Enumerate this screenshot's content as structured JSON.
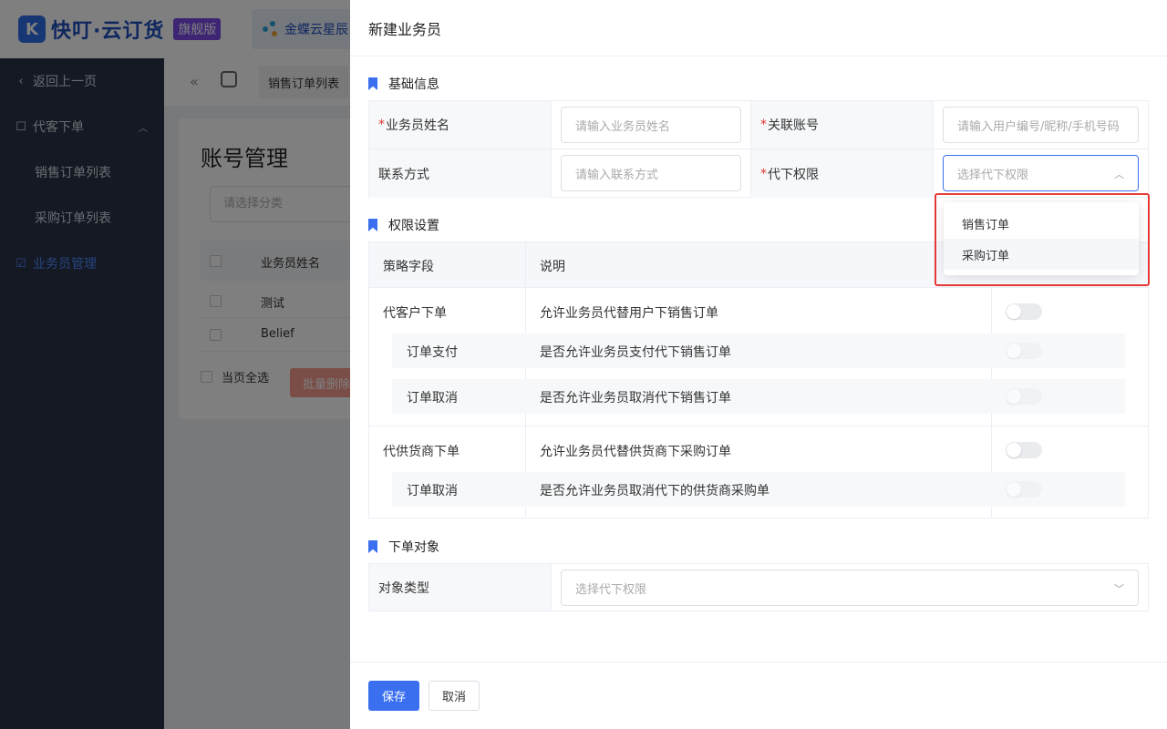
{
  "brand": {
    "logo_mark": "K",
    "name": "快叮·云订货",
    "badge": "旗舰版",
    "partner_tab": "金蝶云星辰"
  },
  "sidebar": {
    "back": "返回上一页",
    "group": "代客下单",
    "items": [
      {
        "label": "销售订单列表"
      },
      {
        "label": "采购订单列表"
      }
    ],
    "active": "业务员管理"
  },
  "breadcrumb": {
    "tab": "销售订单列表"
  },
  "page": {
    "title": "账号管理",
    "category_placeholder": "请选择分类",
    "table_header": "业务员姓名",
    "rows": [
      {
        "name": "测试"
      },
      {
        "name": "Belief"
      }
    ],
    "select_all": "当页全选",
    "bulk_delete": "批量删除"
  },
  "drawer": {
    "title": "新建业务员",
    "basic": {
      "title": "基础信息",
      "name_label": "业务员姓名",
      "name_placeholder": "请输入业务员姓名",
      "account_label": "关联账号",
      "account_placeholder": "请输入用户编号/昵称/手机号码",
      "contact_label": "联系方式",
      "contact_placeholder": "请输入联系方式",
      "proxy_label": "代下权限",
      "proxy_placeholder": "选择代下权限"
    },
    "perm": {
      "title": "权限设置",
      "col_field": "策略字段",
      "col_desc": "说明",
      "rows": [
        {
          "field": "代客户下单",
          "desc": "允许业务员代替用户下销售订单"
        },
        {
          "field": "订单支付",
          "desc": "是否允许业务员支付代下销售订单"
        },
        {
          "field": "订单取消",
          "desc": "是否允许业务员取消代下销售订单"
        },
        {
          "field": "代供货商下单",
          "desc": "允许业务员代替供货商下采购订单"
        },
        {
          "field": "订单取消",
          "desc": "是否允许业务员取消代下的供货商采购单"
        }
      ]
    },
    "target": {
      "title": "下单对象",
      "label": "对象类型",
      "placeholder": "选择代下权限"
    },
    "save": "保存",
    "cancel": "取消"
  },
  "dropdown": {
    "options": [
      "销售订单",
      "采购订单"
    ]
  },
  "colors": {
    "primary": "#3a6ff0",
    "highlight": "#e53935",
    "sidebar": "#2b3346"
  }
}
